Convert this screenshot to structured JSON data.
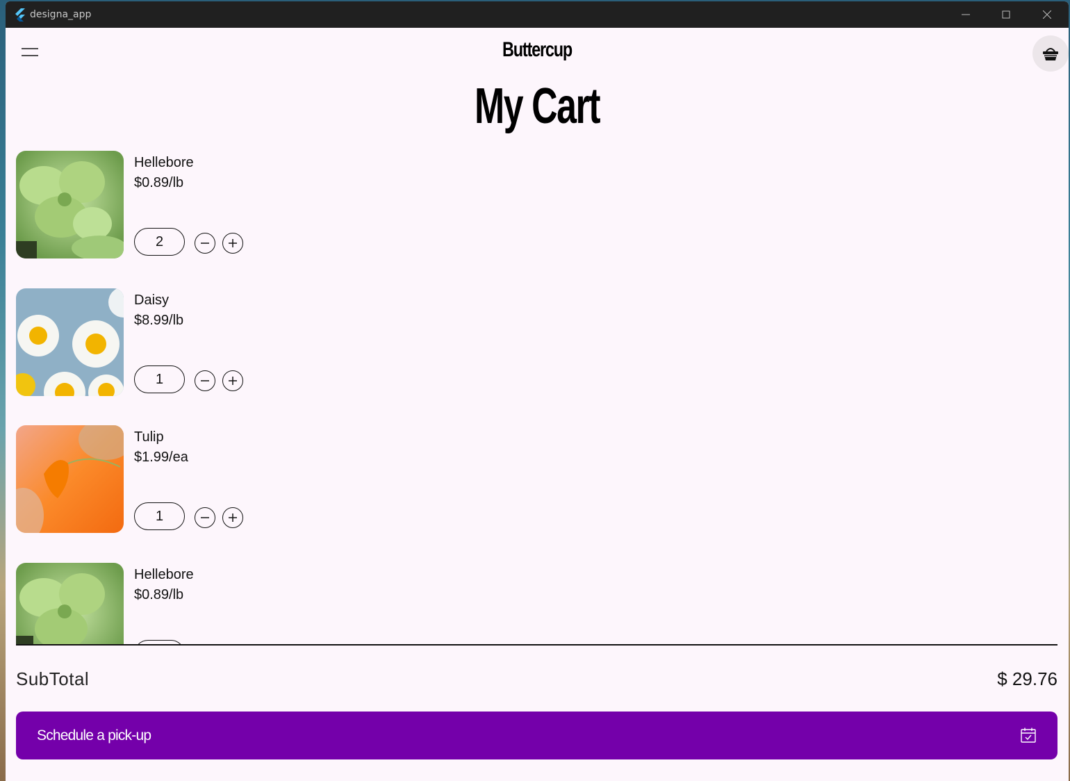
{
  "window": {
    "title": "designa_app"
  },
  "header": {
    "brand": "Buttercup",
    "menu_icon": "menu-icon",
    "cart_icon": "basket-icon"
  },
  "page": {
    "title": "My Cart"
  },
  "cart": {
    "items": [
      {
        "name": "Hellebore",
        "price": "$0.89/lb",
        "quantity": "2",
        "image": "hellebore"
      },
      {
        "name": "Daisy",
        "price": "$8.99/lb",
        "quantity": "1",
        "image": "daisy"
      },
      {
        "name": "Tulip",
        "price": "$1.99/ea",
        "quantity": "1",
        "image": "tulip"
      },
      {
        "name": "Hellebore",
        "price": "$0.89/lb",
        "quantity": "",
        "image": "hellebore"
      }
    ]
  },
  "summary": {
    "subtotal_label": "SubTotal",
    "subtotal_value": "$ 29.76"
  },
  "cta": {
    "label": "Schedule a pick-up",
    "icon": "calendar-check-icon"
  },
  "colors": {
    "accent": "#7400aa",
    "background": "#fdf6fc"
  }
}
